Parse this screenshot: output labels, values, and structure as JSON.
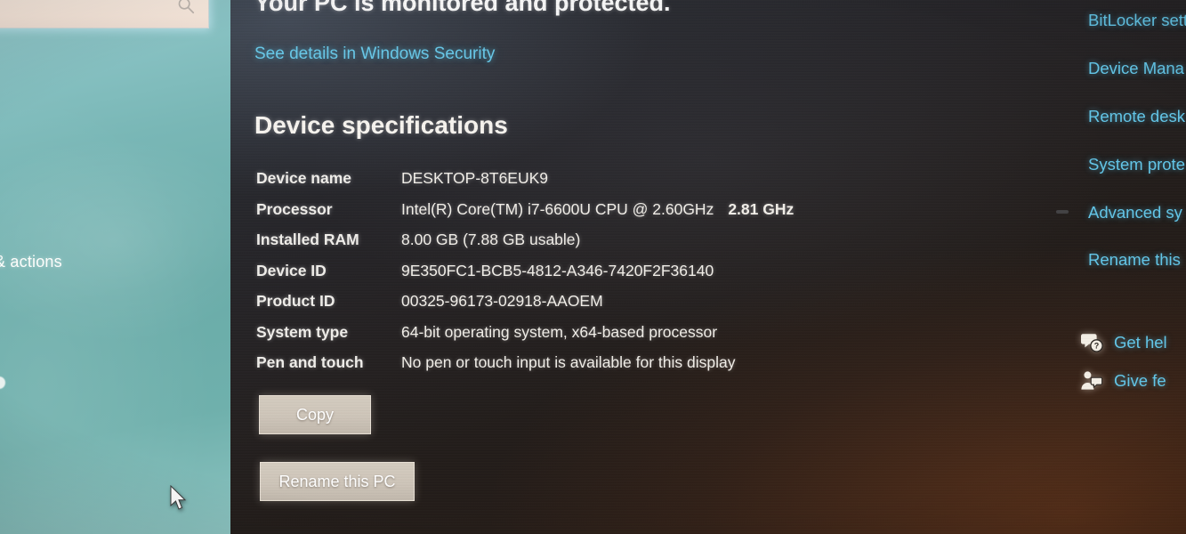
{
  "sidebar": {
    "search_placeholder": "",
    "search_icon": "search-icon",
    "nav_label_partial": "& actions"
  },
  "main": {
    "protected_heading": "Your PC is monitored and protected.",
    "security_link": "See details in Windows Security",
    "section_heading": "Device specifications",
    "specs": [
      {
        "label": "Device name",
        "value": "DESKTOP-8T6EUK9"
      },
      {
        "label": "Processor",
        "value": "Intel(R) Core(TM) i7-6600U CPU @ 2.60GHz",
        "extra": "2.81 GHz"
      },
      {
        "label": "Installed RAM",
        "value": "8.00 GB (7.88 GB usable)"
      },
      {
        "label": "Device ID",
        "value": "9E350FC1-BCB5-4812-A346-7420F2F36140"
      },
      {
        "label": "Product ID",
        "value": "00325-96173-02918-AAOEM"
      },
      {
        "label": "System type",
        "value": "64-bit operating system, x64-based processor"
      },
      {
        "label": "Pen and touch",
        "value": "No pen or touch input is available for this display"
      }
    ],
    "copy_button": "Copy",
    "rename_button": "Rename this PC"
  },
  "right_rail": {
    "links": [
      "BitLocker sett",
      "Device Mana",
      "Remote desk",
      "System prote",
      "Advanced sy",
      "Rename this"
    ],
    "help_rows": [
      {
        "icon": "help-question-bubble-icon",
        "label": "Get hel"
      },
      {
        "icon": "feedback-person-bubble-icon",
        "label": "Give fe"
      }
    ]
  },
  "colors": {
    "link_blue": "#63c6e8",
    "sidebar_teal": "#79b7b6",
    "button_face": "#cec5b9",
    "panel_dark": "#262529"
  }
}
